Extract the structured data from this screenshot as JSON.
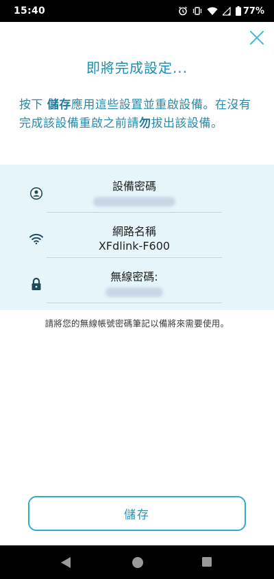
{
  "status_bar": {
    "time": "15:40",
    "battery_percent": "77%",
    "icons": [
      "alarm-icon",
      "vibrate-icon",
      "wifi-icon",
      "signal-icon",
      "battery-icon"
    ]
  },
  "header": {
    "title": "即將完成設定..."
  },
  "instructions": {
    "part1": "按下 ",
    "save_word": "儲存",
    "part2": "應用這些設置並重啟設備。在沒有完成該設備重啟之前請",
    "no_word": "勿",
    "part3": "拔出該設備。"
  },
  "info_panel": {
    "rows": [
      {
        "icon": "user-icon",
        "label": "設備密碼",
        "value": ""
      },
      {
        "icon": "wifi-icon",
        "label": "網路名稱",
        "value": "XFdlink-F600"
      },
      {
        "icon": "lock-icon",
        "label": "無線密碼:",
        "value": ""
      }
    ]
  },
  "note": "請將您的無線帳號密碼筆記以備將來需要使用。",
  "actions": {
    "save_label": "儲存"
  },
  "colors": {
    "accent": "#1a8fb3",
    "panel_bg": "#e5f5fa",
    "button_border": "#35a8cc"
  }
}
